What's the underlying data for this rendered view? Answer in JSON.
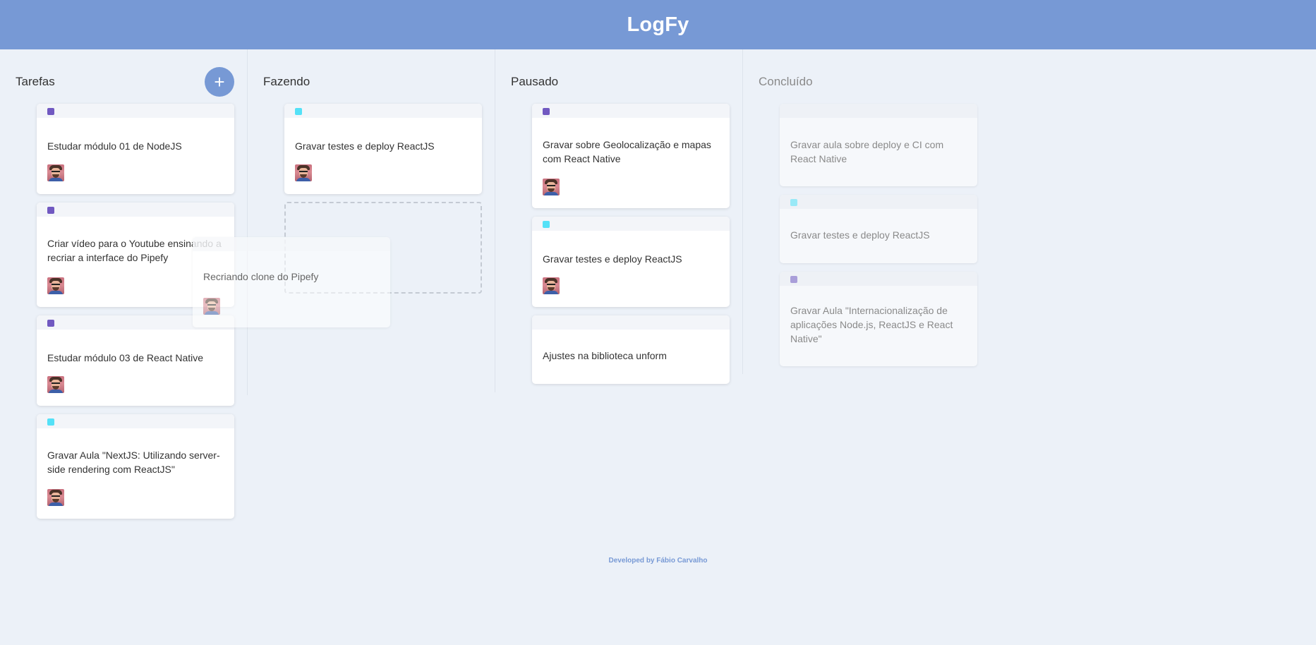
{
  "app": {
    "title": "LogFy"
  },
  "columns": [
    {
      "title": "Tarefas",
      "add_label": "+",
      "cards": [
        {
          "title": "Estudar módulo 01 de NodeJS",
          "label_color": "#7159c1"
        },
        {
          "title": "Criar vídeo para o Youtube ensinando a recriar a interface do Pipefy",
          "label_color": "#7159c1"
        },
        {
          "title": "Estudar módulo 03 de React Native",
          "label_color": "#7159c1"
        },
        {
          "title": "Gravar Aula \"NextJS: Utilizando server-side rendering com ReactJS\"",
          "label_color": "#54e1f7"
        }
      ]
    },
    {
      "title": "Fazendo",
      "cards": [
        {
          "title": "Gravar testes e deploy ReactJS",
          "label_color": "#54e1f7"
        }
      ]
    },
    {
      "title": "Pausado",
      "cards": [
        {
          "title": "Gravar sobre Geolocalização e mapas com React Native",
          "label_color": "#7159c1"
        },
        {
          "title": "Gravar testes e deploy ReactJS",
          "label_color": "#54e1f7"
        },
        {
          "title": "Ajustes na biblioteca unform",
          "label_color": ""
        }
      ]
    },
    {
      "title": "Concluído",
      "cards": [
        {
          "title": "Gravar aula sobre deploy e CI com React Native",
          "label_color": ""
        },
        {
          "title": "Gravar testes e deploy ReactJS",
          "label_color": "#54e1f7"
        },
        {
          "title": "Gravar Aula \"Internacionalização de aplicações Node.js, ReactJS e React Native\"",
          "label_color": "#7159c1"
        }
      ]
    }
  ],
  "dragging": {
    "title": "Recriando clone do Pipefy"
  },
  "footer": {
    "text": "Developed by Fábio Carvalho"
  },
  "colors": {
    "header": "#7799d5",
    "background": "#ecf1f8",
    "purple_label": "#7159c1",
    "cyan_label": "#54e1f7"
  }
}
